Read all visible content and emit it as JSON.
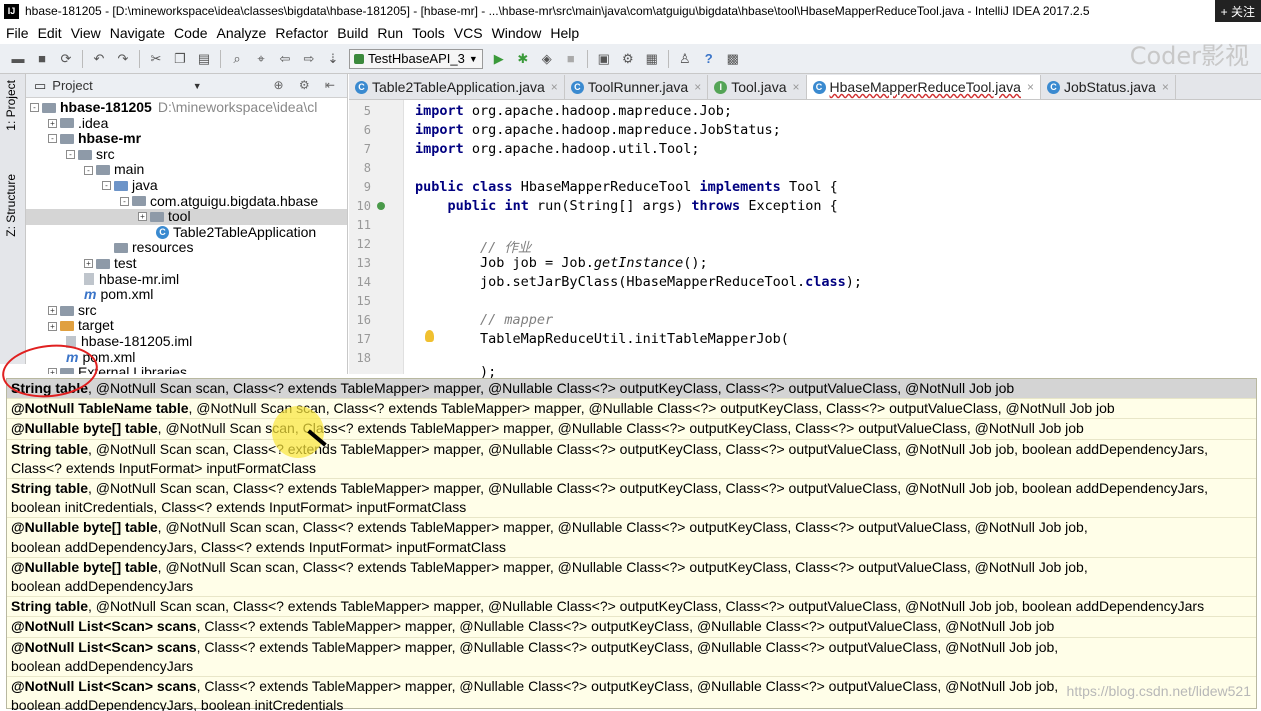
{
  "window": {
    "title": "hbase-181205 - [D:\\mineworkspace\\idea\\classes\\bigdata\\hbase-181205] - [hbase-mr] - ...\\hbase-mr\\src\\main\\java\\com\\atguigu\\bigdata\\hbase\\tool\\HbaseMapperReduceTool.java - IntelliJ IDEA 2017.2.5",
    "follow": "+ 关注"
  },
  "menu": [
    "File",
    "Edit",
    "View",
    "Navigate",
    "Code",
    "Analyze",
    "Refactor",
    "Build",
    "Run",
    "Tools",
    "VCS",
    "Window",
    "Help"
  ],
  "toolbar": {
    "run_config": "TestHbaseAPI_3",
    "watermark": "Coder影视"
  },
  "sidebar_tabs": {
    "project": "1: Project",
    "structure": "Z: Structure"
  },
  "project_panel": {
    "header": "Project",
    "tree": [
      {
        "label": "hbase-181205",
        "path": "D:\\mineworkspace\\idea\\cl",
        "bold": true
      },
      {
        "label": ".idea"
      },
      {
        "label": "hbase-mr",
        "bold": true
      },
      {
        "label": "src"
      },
      {
        "label": "main"
      },
      {
        "label": "java"
      },
      {
        "label": "com.atguigu.bigdata.hbase"
      },
      {
        "label": "tool"
      },
      {
        "label": "Table2TableApplication"
      },
      {
        "label": "resources"
      },
      {
        "label": "test"
      },
      {
        "label": "hbase-mr.iml"
      },
      {
        "label": "pom.xml"
      },
      {
        "label": "src"
      },
      {
        "label": "target"
      },
      {
        "label": "hbase-181205.iml"
      },
      {
        "label": "pom.xml"
      },
      {
        "label": "External Libraries"
      }
    ]
  },
  "editor_tabs": [
    {
      "label": "Table2TableApplication.java",
      "icon": "C"
    },
    {
      "label": "ToolRunner.java",
      "icon": "C"
    },
    {
      "label": "Tool.java",
      "icon": "I"
    },
    {
      "label": "HbaseMapperReduceTool.java",
      "icon": "C",
      "active": true
    },
    {
      "label": "JobStatus.java",
      "icon": "C"
    }
  ],
  "code": {
    "lines": [
      "5",
      "6",
      "7",
      "8",
      "9",
      "10",
      "11",
      "12",
      "13",
      "14",
      "15",
      "16",
      "17",
      "18"
    ],
    "l5": "org.apache.hadoop.mapreduce.Job;",
    "l6": "org.apache.hadoop.mapreduce.JobStatus;",
    "l7": "org.apache.hadoop.util.Tool;",
    "l9_class": "HbaseMapperReduceTool",
    "l9_iface": "Tool {",
    "l10_sig": "run(String[] args)",
    "l10_exc": "Exception {",
    "l12": "// 作业",
    "l13a": "Job job = Job.",
    "l13b": "getInstance",
    "l13c": "();",
    "l14a": "job.setJarByClass(HbaseMapperReduceTool.",
    "l14b": ");",
    "l16": "// mapper",
    "l17": "TableMapReduceUtil.initTableMapperJob(",
    "l19": ");"
  },
  "kw": {
    "import": "import",
    "public": "public",
    "class": "class",
    "implements": "implements",
    "int": "int",
    "throws": "throws",
    "classlit": "class"
  },
  "popup": {
    "rows": [
      {
        "bold": "String table",
        "rest": ", @NotNull Scan scan, Class<? extends TableMapper> mapper, @Nullable Class<?> outputKeyClass, Class<?> outputValueClass, @NotNull Job job",
        "selected": true
      },
      {
        "bold": "@NotNull TableName table",
        "rest": ", @NotNull Scan scan, Class<? extends TableMapper> mapper, @Nullable Class<?> outputKeyClass, Class<?> outputValueClass, @NotNull Job job"
      },
      {
        "bold": "@Nullable byte[] table",
        "rest": ", @NotNull Scan scan, Class<? extends TableMapper> mapper, @Nullable Class<?> outputKeyClass, Class<?> outputValueClass, @NotNull Job job"
      },
      {
        "bold": "String table",
        "rest": ", @NotNull Scan scan, Class<? extends TableMapper> mapper, @Nullable Class<?> outputKeyClass, Class<?> outputValueClass, @NotNull Job job, boolean addDependencyJars,",
        "line2": "Class<? extends InputFormat> inputFormatClass"
      },
      {
        "bold": "String table",
        "rest": ", @NotNull Scan scan, Class<? extends TableMapper> mapper, @Nullable Class<?> outputKeyClass, Class<?> outputValueClass, @NotNull Job job, boolean addDependencyJars,",
        "line2": "boolean initCredentials, Class<? extends InputFormat> inputFormatClass"
      },
      {
        "bold": "@Nullable byte[] table",
        "rest": ", @NotNull Scan scan, Class<? extends TableMapper> mapper, @Nullable Class<?> outputKeyClass, Class<?> outputValueClass, @NotNull Job job,",
        "line2": "boolean addDependencyJars, Class<? extends InputFormat> inputFormatClass"
      },
      {
        "bold": "@Nullable byte[] table",
        "rest": ", @NotNull Scan scan, Class<? extends TableMapper> mapper, @Nullable Class<?> outputKeyClass, Class<?> outputValueClass, @NotNull Job job,",
        "line2": "boolean addDependencyJars"
      },
      {
        "bold": "String table",
        "rest": ", @NotNull Scan scan, Class<? extends TableMapper> mapper, @Nullable Class<?> outputKeyClass, Class<?> outputValueClass, @NotNull Job job, boolean addDependencyJars"
      },
      {
        "bold": "@NotNull List<Scan> scans",
        "rest": ", Class<? extends TableMapper> mapper, @Nullable Class<?> outputKeyClass, @Nullable Class<?> outputValueClass, @NotNull Job job"
      },
      {
        "bold": "@NotNull List<Scan> scans",
        "rest": ", Class<? extends TableMapper> mapper, @Nullable Class<?> outputKeyClass, @Nullable Class<?> outputValueClass, @NotNull Job job,",
        "line2": "boolean addDependencyJars"
      },
      {
        "bold": "@NotNull List<Scan> scans",
        "rest": ", Class<? extends TableMapper> mapper, @Nullable Class<?> outputKeyClass, @Nullable Class<?> outputValueClass, @NotNull Job job,",
        "line2": "boolean addDependencyJars, boolean initCredentials"
      }
    ],
    "watermark": "https://blog.csdn.net/lidew521"
  }
}
